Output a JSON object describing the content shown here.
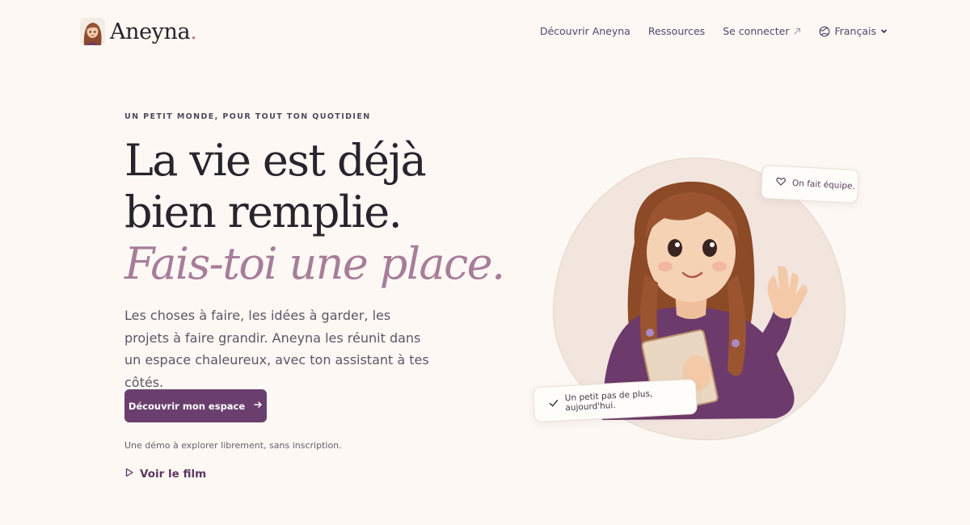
{
  "brand": {
    "name": "Aneyna",
    "dot": "."
  },
  "nav": {
    "discover": "Découvrir Aneyna",
    "resources": "Ressources",
    "login": "Se connecter",
    "language": "Français"
  },
  "hero": {
    "eyebrow": "UN PETIT MONDE, POUR TOUT TON QUOTIDIEN",
    "headline_line1": "La vie est déjà",
    "headline_line2": "bien remplie.",
    "headline_accent": "Fais-toi une place.",
    "lead": "Les choses à faire, les idées à garder, les projets à faire grandir. Aneyna les réunit dans un espace chaleureux, avec ton assistant à tes côtés.",
    "cta": "Découvrir mon espace",
    "note": "Une démo à explorer librement, sans inscription.",
    "film": "Voir le film"
  },
  "illustration": {
    "badge_team": "On fait équipe.",
    "badge_step": "Un petit pas de plus, aujourd'hui."
  },
  "icons": {
    "login": "arrow-up-right-icon",
    "language": "globe-icon",
    "dropdown": "chevron-down-icon",
    "cta": "arrow-right-icon",
    "film": "play-icon",
    "team": "heart-icon",
    "step": "check-icon"
  },
  "colors": {
    "background": "#fdf8f3",
    "primary": "#6a3f6e",
    "accent_text": "#a77d9a",
    "nav_text": "#4b4a70"
  }
}
